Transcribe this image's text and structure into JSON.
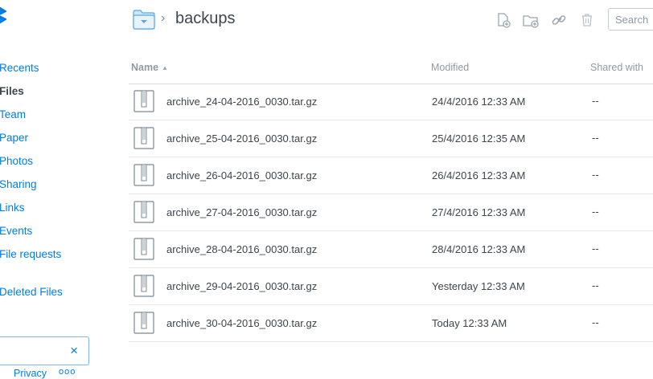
{
  "brand": {
    "accent": "#007ee5",
    "text": "#3d464d",
    "muted": "#8f9aa3"
  },
  "sidebar": {
    "items": [
      {
        "label": "Recents",
        "active": false
      },
      {
        "label": "Files",
        "active": true
      },
      {
        "label": "Team",
        "active": false
      },
      {
        "label": "Paper",
        "active": false
      },
      {
        "label": "Photos",
        "active": false
      },
      {
        "label": "Sharing",
        "active": false
      },
      {
        "label": "Links",
        "active": false
      },
      {
        "label": "Events",
        "active": false
      },
      {
        "label": "File requests",
        "active": false
      },
      {
        "label": "Deleted Files",
        "active": false
      }
    ],
    "notice_close": "×"
  },
  "footer": {
    "privacy": "Privacy",
    "more": "ooo"
  },
  "header": {
    "breadcrumb_sep": "›",
    "title": "backups",
    "tools": [
      "new-file-icon",
      "new-folder-icon",
      "share-link-icon",
      "trash-icon"
    ],
    "search_placeholder": "Search"
  },
  "table": {
    "columns": {
      "name": "Name",
      "modified": "Modified",
      "shared": "Shared with"
    },
    "sort_indicator": "▲",
    "rows": [
      {
        "name": "archive_24-04-2016_0030.tar.gz",
        "modified": "24/4/2016 12:33 AM",
        "shared": "--"
      },
      {
        "name": "archive_25-04-2016_0030.tar.gz",
        "modified": "25/4/2016 12:35 AM",
        "shared": "--"
      },
      {
        "name": "archive_26-04-2016_0030.tar.gz",
        "modified": "26/4/2016 12:33 AM",
        "shared": "--"
      },
      {
        "name": "archive_27-04-2016_0030.tar.gz",
        "modified": "27/4/2016 12:33 AM",
        "shared": "--"
      },
      {
        "name": "archive_28-04-2016_0030.tar.gz",
        "modified": "28/4/2016 12:33 AM",
        "shared": "--"
      },
      {
        "name": "archive_29-04-2016_0030.tar.gz",
        "modified": "Yesterday 12:33 AM",
        "shared": "--"
      },
      {
        "name": "archive_30-04-2016_0030.tar.gz",
        "modified": "Today 12:33 AM",
        "shared": "--"
      }
    ]
  }
}
